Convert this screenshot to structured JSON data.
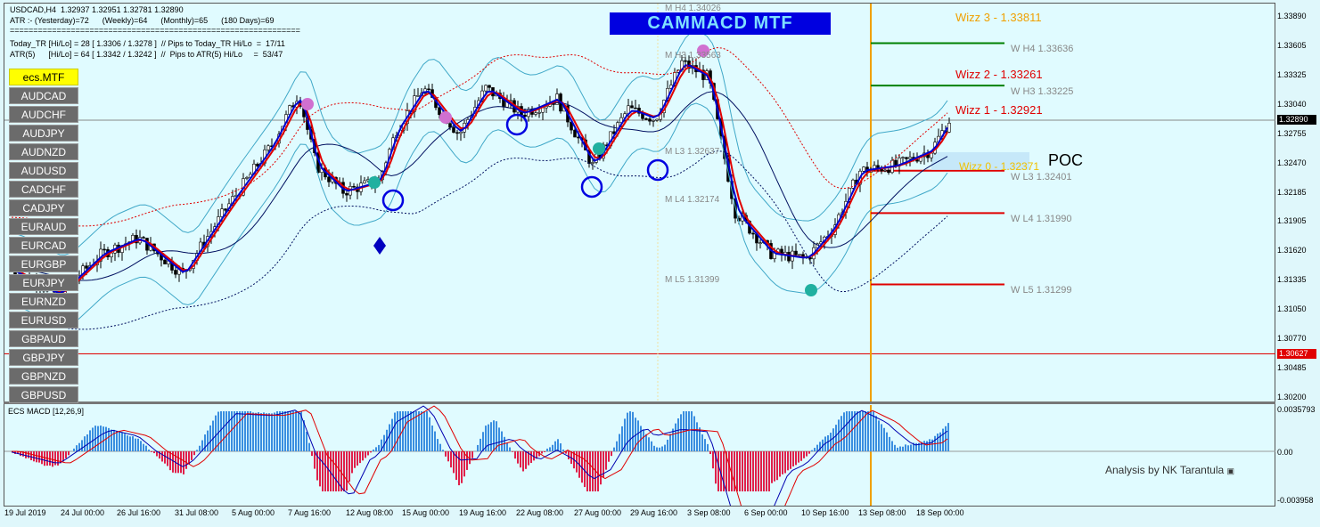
{
  "chart_window": {
    "symbol_line": "USDCAD,H4  1.32937 1.32951 1.32781 1.32890",
    "atr_line": "ATR :- (Yesterday)=72      (Weekly)=64      (Monthly)=65      (180 Days)=69",
    "separator_line": "==============================================================",
    "today_tr_line": "Today_TR [Hi/Lo] = 28 [ 1.3306 / 1.3278 ]  // Pips to Today_TR Hi/Lo  =  17/11",
    "atr5_line": "ATR(5)      [Hi/Lo] = 64 [ 1.3342 / 1.3242 ]  //  Pips to ATR(5) Hi/Lo     =  53/47",
    "title_banner": "CAMMACD MTF",
    "poc_label": "POC",
    "analysis_label": "Analysis by NK Tarantula",
    "macd_label": "ECS MACD [12,26,9]"
  },
  "symbol_buttons": {
    "active": "ecs.MTF",
    "items": [
      "AUDCAD",
      "AUDCHF",
      "AUDJPY",
      "AUDNZD",
      "AUDUSD",
      "CADCHF",
      "CADJPY",
      "EURAUD",
      "EURCAD",
      "EURGBP",
      "EURJPY",
      "EURNZD",
      "EURUSD",
      "GBPAUD",
      "GBPJPY",
      "GBPNZD",
      "GBPUSD"
    ]
  },
  "price_axis": {
    "ticks": [
      "1.33890",
      "1.33605",
      "1.33325",
      "1.33040",
      "1.32755",
      "1.32470",
      "1.32185",
      "1.31905",
      "1.31620",
      "1.31335",
      "1.31050",
      "1.30770",
      "1.30485",
      "1.30200"
    ],
    "current_price": "1.32890",
    "red_line_price": "1.30627",
    "current_price_color": "#000000",
    "red_line_color": "#e00000"
  },
  "macd_axis": {
    "top": "0.0035793",
    "zero": "0.00",
    "bottom": "-0.003958"
  },
  "time_axis": [
    "19 Jul 2019",
    "24 Jul 00:00",
    "26 Jul 16:00",
    "31 Jul 08:00",
    "5 Aug 00:00",
    "7 Aug 16:00",
    "12 Aug 08:00",
    "15 Aug 00:00",
    "19 Aug 16:00",
    "22 Aug 08:00",
    "27 Aug 00:00",
    "29 Aug 16:00",
    "3 Sep 08:00",
    "6 Sep 00:00",
    "10 Sep 16:00",
    "13 Sep 08:00",
    "18 Sep 00:00"
  ],
  "monthly_levels": {
    "h4": "M  H4 1.34026",
    "h3": "M  H3 1.33563",
    "l3": "M  L3 1.32637",
    "l4": "M  L4 1.32174",
    "l5": "M  L5 1.31399"
  },
  "weekly_levels": {
    "h4": "W  H4 1.33636",
    "h3": "W  H3 1.33225",
    "l3": "W  L3 1.32401",
    "l4": "W  L4 1.31990",
    "l5": "W  L5 1.31299"
  },
  "wizz_levels": {
    "wizz3": "Wizz 3 - 1.33811",
    "wizz2": "Wizz 2 - 1.33261",
    "wizz1": "Wizz 1 - 1.32921",
    "wizz0": "Wizz 0 - 1.32371",
    "wizz3_color": "#f0a000",
    "wizz2_color": "#e00000",
    "wizz1_color": "#e00000",
    "wizz0_color": "#f0c000"
  },
  "colors": {
    "background": "#e0fbff",
    "bull_hist": "#3a8ee0",
    "bear_hist": "#e0204a",
    "ma_red": "#e00000",
    "ma_blue": "#0000d0",
    "bollinger": "#40a8c8",
    "session_line": "#f0a000"
  }
}
